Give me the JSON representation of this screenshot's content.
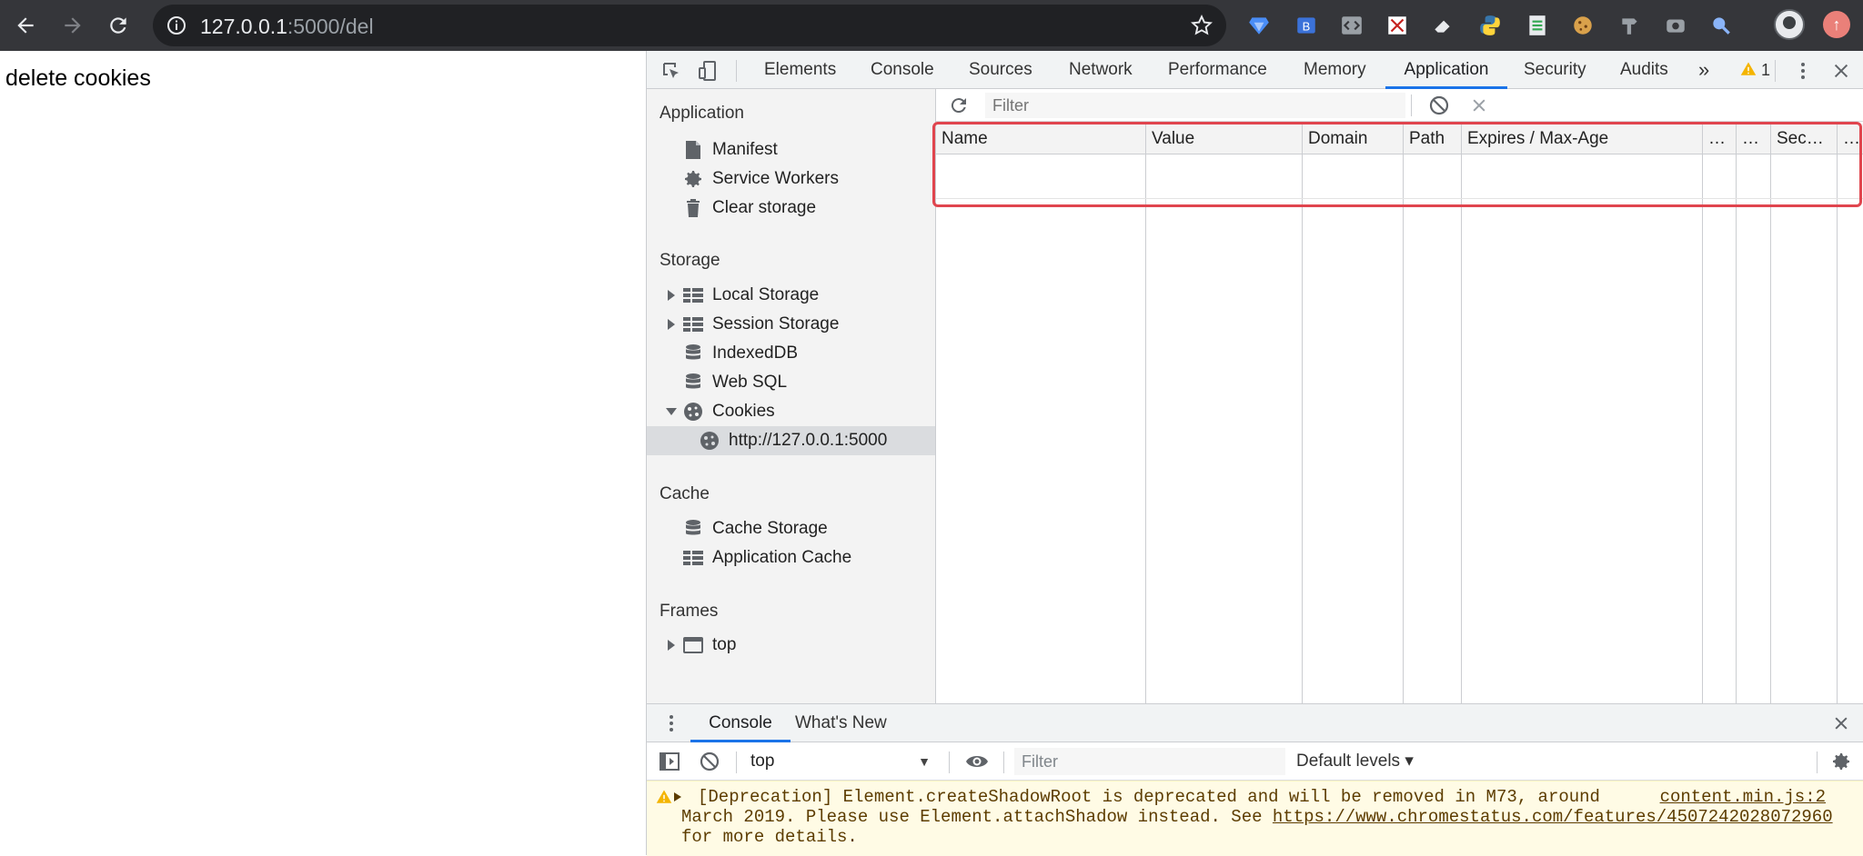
{
  "browser": {
    "url_host": "127.0.0.1",
    "url_path": ":5000/del"
  },
  "page": {
    "text": "delete cookies"
  },
  "devtools": {
    "tabs": [
      "Elements",
      "Console",
      "Sources",
      "Network",
      "Performance",
      "Memory",
      "Application",
      "Security",
      "Audits"
    ],
    "active_tab": "Application",
    "overflow_label": "»",
    "warning_count": "1",
    "sidebar": {
      "application_title": "Application",
      "application_items": [
        "Manifest",
        "Service Workers",
        "Clear storage"
      ],
      "storage_title": "Storage",
      "storage_items": [
        "Local Storage",
        "Session Storage",
        "IndexedDB",
        "Web SQL",
        "Cookies"
      ],
      "cookie_origin": "http://127.0.0.1:5000",
      "cache_title": "Cache",
      "cache_items": [
        "Cache Storage",
        "Application Cache"
      ],
      "frames_title": "Frames",
      "frames_items": [
        "top"
      ]
    },
    "cookies": {
      "filter_placeholder": "Filter",
      "columns": [
        "Name",
        "Value",
        "Domain",
        "Path",
        "Expires / Max-Age",
        "…",
        "…",
        "Sec…",
        "…"
      ]
    },
    "drawer": {
      "tabs": [
        "Console",
        "What's New"
      ],
      "active_tab": "Console",
      "context": "top",
      "filter_placeholder": "Filter",
      "levels": "Default levels ▾",
      "message": {
        "text": "[Deprecation] Element.createShadowRoot is deprecated and will be removed in M73, around",
        "url_line_prefix": "March 2019. Please use Element.attachShadow instead. See ",
        "url": "https://www.chromestatus.com/features/4507242028072960",
        "suffix": " for more details.",
        "source": "content.min.js:2"
      }
    }
  },
  "colors": {
    "accent": "#1a73e8",
    "highlight": "#e0454e",
    "warning_bg": "#fffbe5"
  }
}
